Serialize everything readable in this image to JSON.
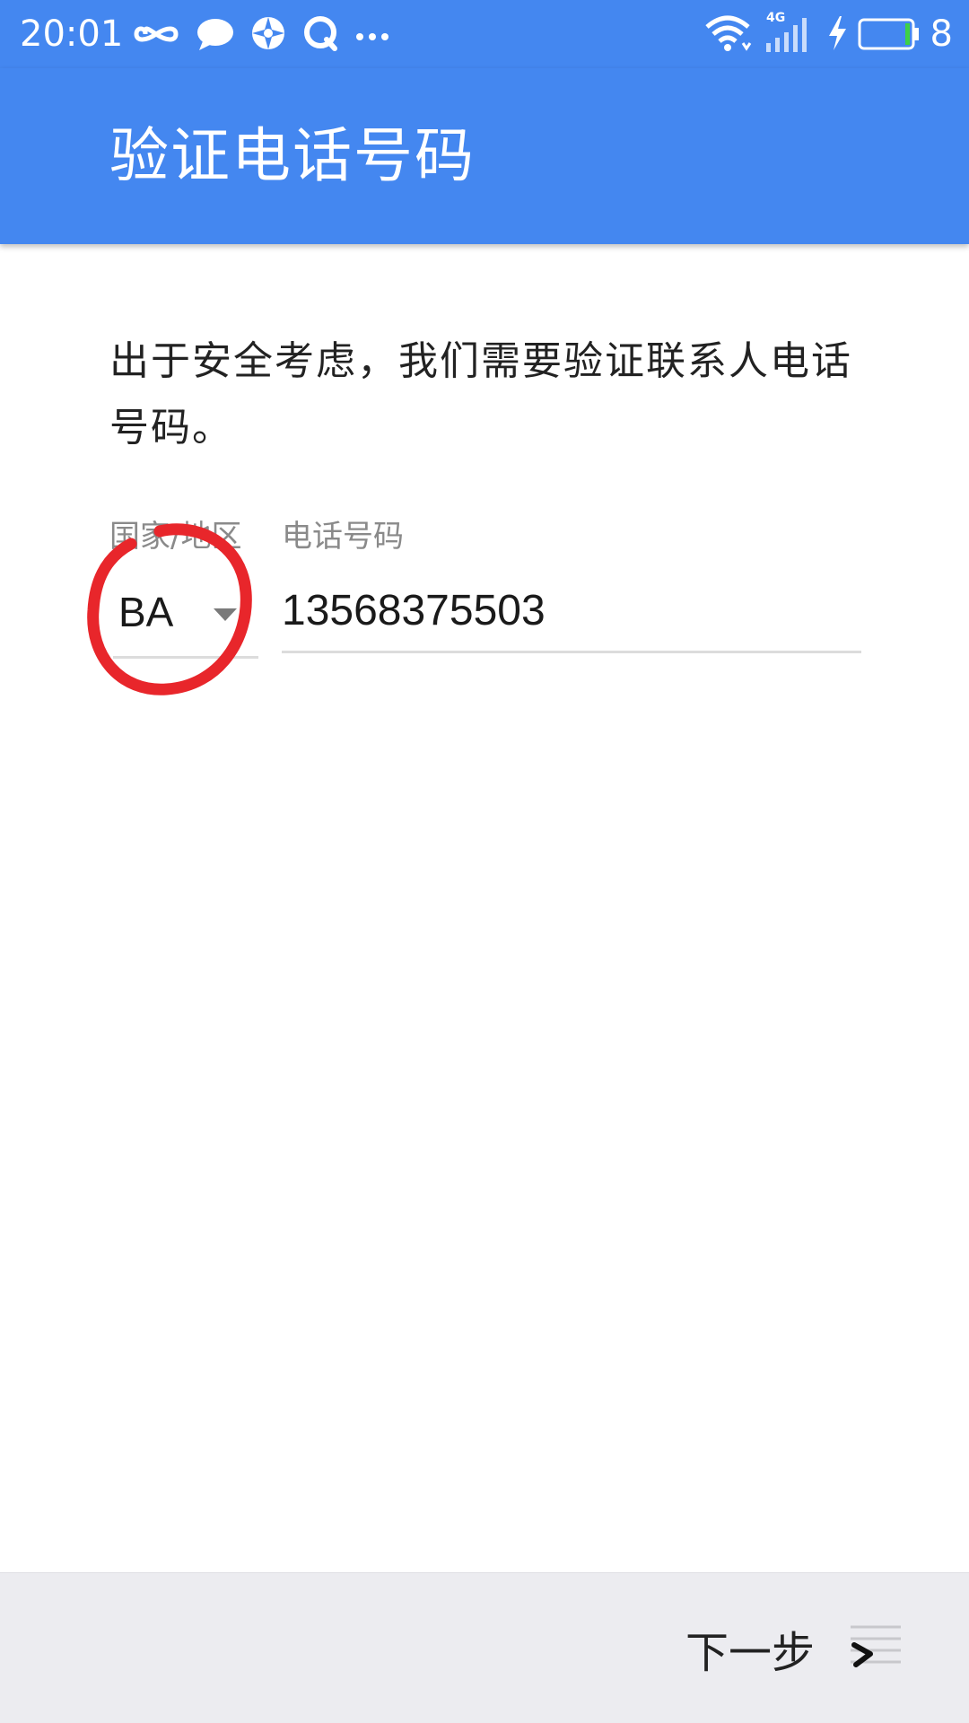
{
  "status_bar": {
    "time": "20:01",
    "network": "4G",
    "battery_level": "8",
    "icons": [
      "infinity-icon",
      "chat-icon",
      "browser-icon",
      "qq-icon",
      "more-icon",
      "wifi-icon",
      "signal-icon",
      "charging-icon",
      "battery-icon"
    ]
  },
  "app_bar": {
    "title": "验证电话号码",
    "background_color": "#4487f0"
  },
  "content": {
    "description": "出于安全考虑，我们需要验证联系人电话号码。",
    "country_label": "国家/地区",
    "country_value": "BA",
    "phone_label": "电话号码",
    "phone_value": "13568375503"
  },
  "bottom_bar": {
    "next_label": "下一步"
  },
  "annotation": {
    "color": "#e8262b"
  }
}
